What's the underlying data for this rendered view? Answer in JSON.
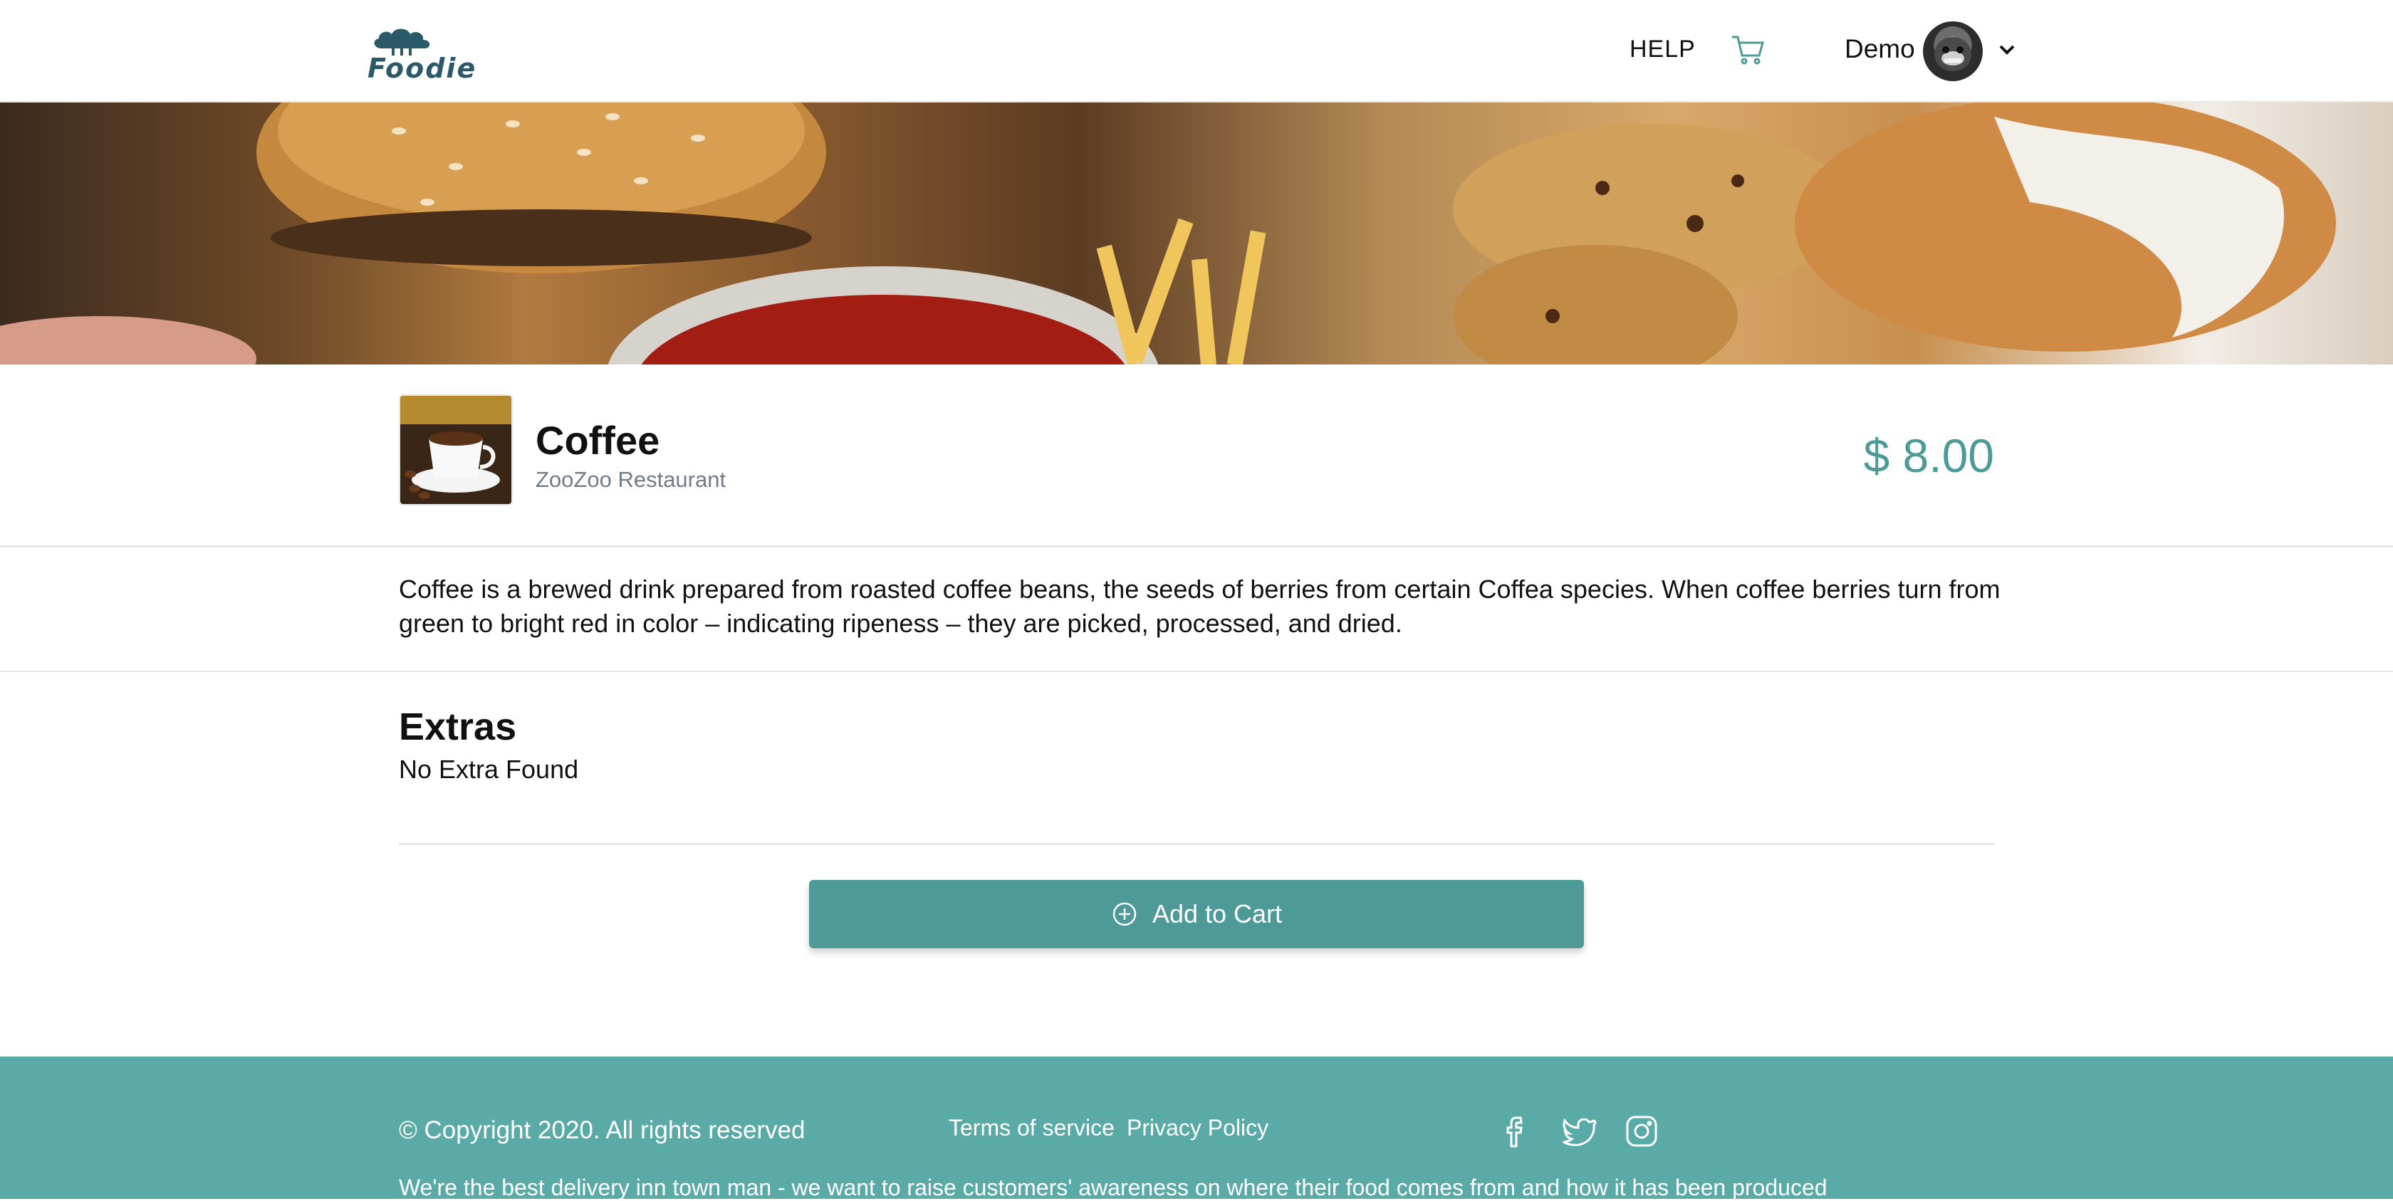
{
  "header": {
    "logo_text": "Foodie",
    "help_label": "HELP",
    "user_name": "Demo",
    "icons": {
      "cart": "cart-icon",
      "chevron": "chevron-down-icon"
    }
  },
  "product": {
    "title": "Coffee",
    "restaurant": "ZooZoo Restaurant",
    "price": "$ 8.00",
    "description": "Coffee is a brewed drink prepared from roasted coffee beans, the seeds of berries from certain Coffea species. When coffee berries turn from green to bright red in color – indicating ripeness – they are picked, processed, and dried."
  },
  "extras": {
    "title": "Extras",
    "empty_text": "No Extra Found"
  },
  "actions": {
    "add_to_cart_label": "Add to Cart"
  },
  "footer": {
    "copyright": "© Copyright 2020. All rights reserved",
    "links": [
      "Terms of service",
      "Privacy Policy"
    ],
    "social": [
      "facebook-icon",
      "twitter-icon",
      "instagram-icon"
    ],
    "tagline": "We're the best delivery inn town man - we want to raise customers' awareness on where their food comes from and how it has been produced"
  },
  "colors": {
    "accent": "#4e9a98",
    "footer_bg": "#5aaba7",
    "logo": "#2a5a6a",
    "muted_text": "#6e7c8c"
  }
}
